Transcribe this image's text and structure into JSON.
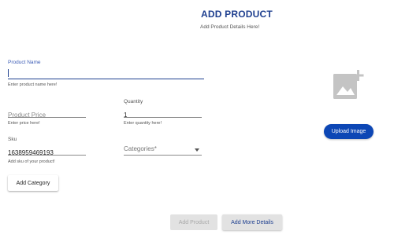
{
  "header": {
    "title": "ADD PRODUCT",
    "subtitle": "Add Product Details Here!"
  },
  "form": {
    "product_name": {
      "label": "Product Name",
      "value": "",
      "helper": "Enter product name here!"
    },
    "price": {
      "placeholder": "Product Price",
      "value": "",
      "helper": "Enter price here!"
    },
    "quantity": {
      "label": "Quantity",
      "value": "1",
      "helper": "Enter quantity here!"
    },
    "sku": {
      "label": "Sku",
      "value": "1638959469193",
      "helper": "Add sku of your product!"
    },
    "categories": {
      "placeholder": "Categories*",
      "selected": ""
    }
  },
  "buttons": {
    "add_category": "Add Category",
    "upload_image": "Upload Image",
    "add_product": "Add Product",
    "add_more_details": "Add More Details"
  },
  "icons": {
    "image_placeholder": "add-photo-icon"
  },
  "colors": {
    "accent": "#1e3f8f",
    "primary_button": "#0d47b5",
    "icon_gray": "#c4c4c4"
  }
}
